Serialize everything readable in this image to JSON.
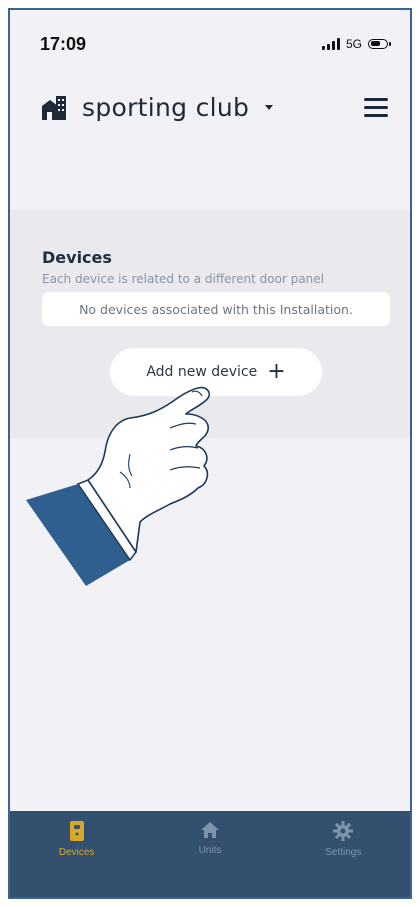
{
  "status_bar": {
    "time": "17:09",
    "network": "5G"
  },
  "header": {
    "installation_name": "sporting club"
  },
  "devices_section": {
    "title": "Devices",
    "subtitle": "Each device is related to a different door panel",
    "empty_message": "No devices associated with this Installation.",
    "add_button_label": "Add new device"
  },
  "tabbar": {
    "tabs": [
      {
        "label": "Devices",
        "icon": "door-panel-icon",
        "active": true
      },
      {
        "label": "Units",
        "icon": "home-icon",
        "active": false
      },
      {
        "label": "Settings",
        "icon": "gear-icon",
        "active": false
      }
    ]
  },
  "colors": {
    "accent": "#d7a829",
    "tabbar_bg": "#33516e",
    "hand_cuff": "#2f5f8f"
  }
}
